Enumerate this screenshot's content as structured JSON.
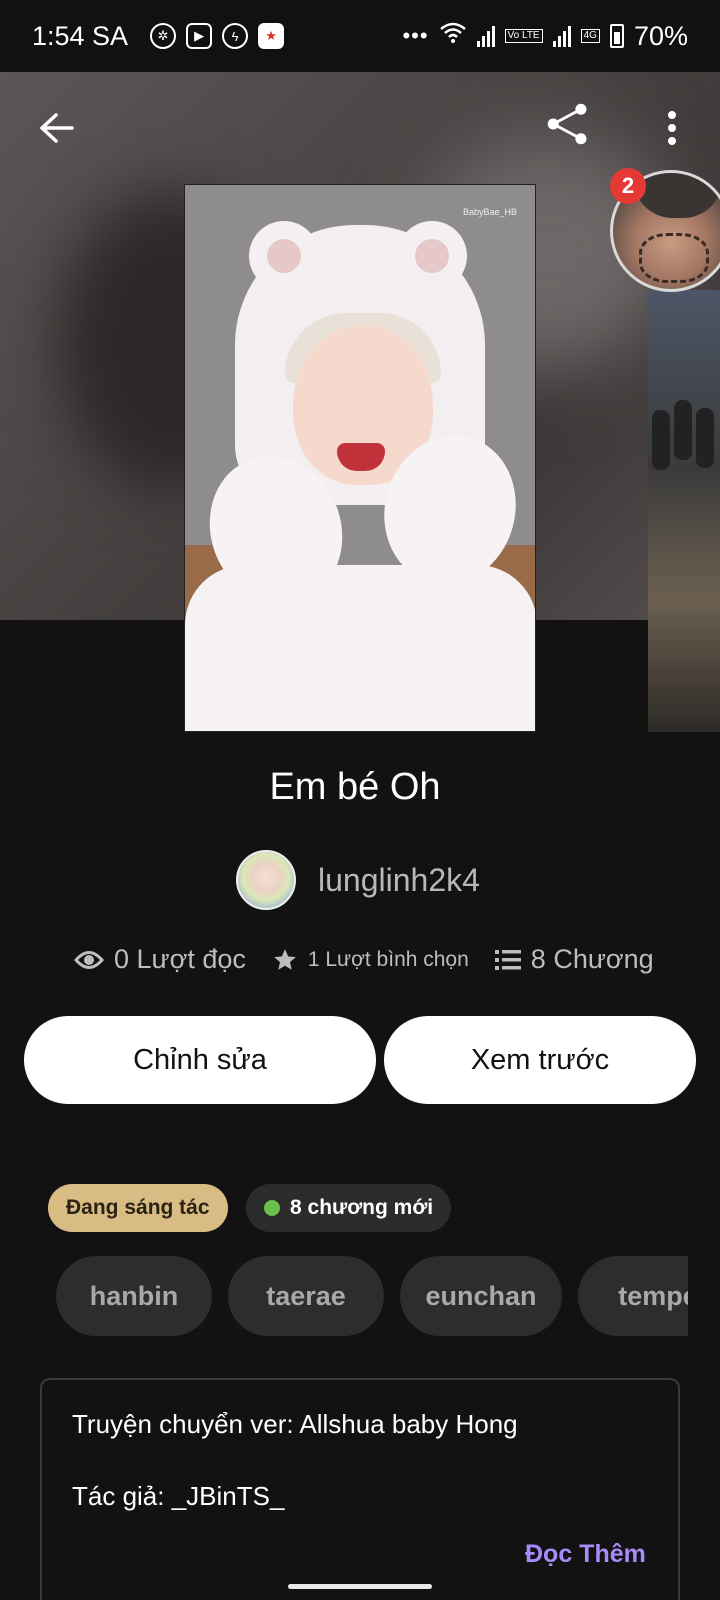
{
  "status_bar": {
    "time": "1:54 SA",
    "battery": "70%",
    "network_label": "4G",
    "volte_label": "Vo LTE"
  },
  "story": {
    "title": "Em bé Oh",
    "author": "lunglinh2k4",
    "notification_count": "2",
    "reads": "0 Lượt đọc",
    "votes": "1 Lượt bình chọn",
    "chapters": "8 Chương",
    "edit_label": "Chỉnh sửa",
    "preview_label": "Xem trước",
    "status_label": "Đang sáng tác",
    "new_chapters_label": "8 chương mới",
    "tags": [
      "hanbin",
      "taerae",
      "eunchan",
      "tempe"
    ],
    "description": [
      "Truyện chuyển ver: Allshua baby Hong",
      "Tác giả: _JBinTS_"
    ],
    "read_more_label": "Đọc Thêm",
    "cover_watermark": "BabyBae_HB"
  },
  "colors": {
    "background": "#121212",
    "status_chip": "#d9bb84",
    "new_dot": "#6bbf4b",
    "badge": "#e53935",
    "read_more": "#a78bfa"
  }
}
